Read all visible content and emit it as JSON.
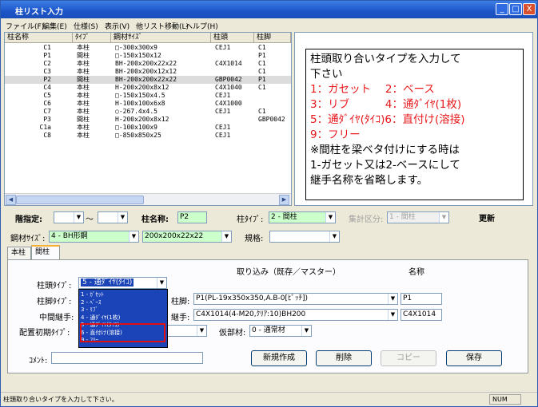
{
  "window": {
    "title": "柱リスト入力",
    "buttons": [
      "_",
      "□",
      "X"
    ]
  },
  "menu": [
    "ファイル(F)",
    "編集(E)",
    "仕様(S)",
    "表示(V)",
    "他リスト移動(L)",
    "ヘルプ(H)"
  ],
  "list": {
    "columns": [
      "柱名称",
      "ﾀｲﾌﾟ",
      "鋼材ｻｲｽﾞ",
      "柱頭",
      "柱脚"
    ],
    "rows": [
      [
        "C1",
        "本柱",
        "□-300x300x9",
        "CEJ1",
        "C1"
      ],
      [
        "P1",
        "間柱",
        "□-150x150x12",
        "",
        "P1"
      ],
      [
        "C2",
        "本柱",
        "BH-200x200x22x22",
        "C4X1014",
        "C1"
      ],
      [
        "C3",
        "本柱",
        "BH-200x200x12x12",
        "",
        "C1"
      ],
      [
        "P2",
        "間柱",
        "BH-200x200x22x22",
        "GBP0042",
        "P1"
      ],
      [
        "C4",
        "本柱",
        "H-200x200x8x12",
        "C4X1040",
        "C1"
      ],
      [
        "C5",
        "本柱",
        "□-150x150x4.5",
        "CEJ1",
        ""
      ],
      [
        "C6",
        "本柱",
        "H-100x100x6x8",
        "C4X1000",
        ""
      ],
      [
        "C7",
        "本柱",
        "○-267.4x4.5",
        "CEJ1",
        "C1"
      ],
      [
        "P3",
        "間柱",
        "H-200x200x8x12",
        "",
        "GBP0042"
      ],
      [
        "C1a",
        "本柱",
        "□-100x100x9",
        "CEJ1",
        ""
      ],
      [
        "C8",
        "本柱",
        "□-850x850x25",
        "CEJ1",
        ""
      ]
    ],
    "selected_index": 4
  },
  "note": {
    "lines": [
      {
        "text": "柱頭取り合いタイプを入力して",
        "red": false
      },
      {
        "text": "下さい",
        "red": false
      },
      {
        "text": "1：ガセット　 2：ベース",
        "red": true
      },
      {
        "text": "3：リブ　　　 4：通ﾀﾞｲﾔ(1枚)",
        "red": true
      },
      {
        "text": "5：通ﾀﾞｲﾔ(ﾀｲｺ)6：直付け(溶接)",
        "red": true
      },
      {
        "text": "9：フリー",
        "red": true
      },
      {
        "text": "※間柱を梁ベタ付けにする時は",
        "red": false
      },
      {
        "text": "1-ガセット又は2-ベースにして",
        "red": false
      },
      {
        "text": "継手名称を省略します。",
        "red": false
      }
    ]
  },
  "form": {
    "kai_label": "階指定:",
    "kai_from": "",
    "kai_to": "",
    "tilde": "～",
    "hashira_label": "柱名称:",
    "hashira_value": "P2",
    "type_label": "柱ﾀｲﾌﾟ:",
    "type_value": "2 - 間柱",
    "shukei_label": "集計区分:",
    "shukei_value": "1 - 間柱",
    "update_button": "更新",
    "steel_label": "鋼材ｻｲｽﾞ:",
    "steel_kind": "4 - BH形鋼",
    "steel_size": "200x200x22x22",
    "kikaku_label": "規格:",
    "kikaku_value": ""
  },
  "tabs": [
    "本柱",
    "間柱"
  ],
  "panel": {
    "import_header": "取り込み（既存／マスター）",
    "name_header": "名称",
    "head_type_label": "柱頭ﾀｲﾌﾟ:",
    "head_type_value": "5 - 通ﾀﾞｲﾔ(ﾀｲｺ)",
    "foot_type_label": "柱脚ﾀｲﾌﾟ:",
    "foot_label": "柱脚:",
    "foot_value": "P1(PL-19x350x350,A.B-0[ﾋﾟｯﾁ])",
    "foot_name": "P1",
    "joint_label": "中間継手:",
    "joint_sub_label": "継手:",
    "joint_value": "C4X1014(4-M20,ｸﾘｱ:10)BH200",
    "joint_name": "C4X1014",
    "initial_label": "配置初期ﾀｲﾌﾟ:",
    "temp_label": "仮部材:",
    "temp_value": "0 - 通常材",
    "comment_label": "ｺﾒﾝﾄ:",
    "comment_value": "",
    "buttons": [
      "新規作成",
      "削除",
      "コピー",
      "保存"
    ]
  },
  "dropdown_options": [
    "1 - ｶﾞｾｯﾄ",
    "2 - ﾍﾞｰｽ",
    "3 - ﾘﾌﾞ",
    "4 - 通ﾀﾞｲﾔ(1枚)",
    "5 - 通ﾀﾞｲﾔ(ﾀｲｺ)",
    "6 - 直付け(溶接)",
    "9 - ﾌﾘｰ"
  ],
  "status": {
    "text": "柱頭取り合いタイプを入力して下さい。",
    "num": "NUM"
  }
}
